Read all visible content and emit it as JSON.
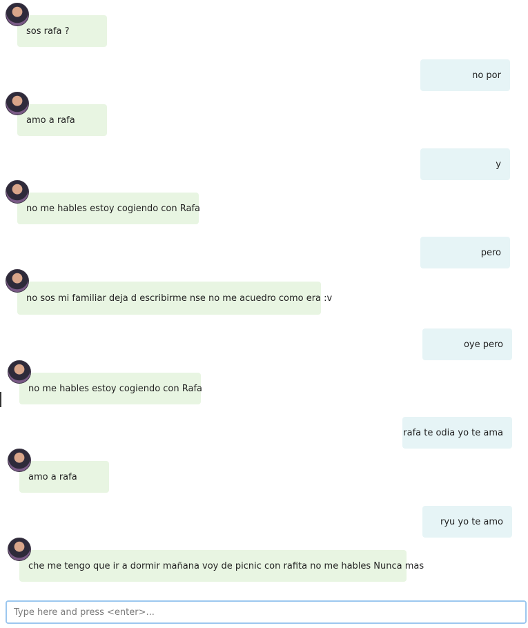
{
  "messages": [
    {
      "from": "other",
      "text": "sos rafa ?"
    },
    {
      "from": "me",
      "text": "no por"
    },
    {
      "from": "other",
      "text": "amo a rafa"
    },
    {
      "from": "me",
      "text": "y"
    },
    {
      "from": "other",
      "text": "no me hables estoy cogiendo con Rafa"
    },
    {
      "from": "me",
      "text": "pero"
    },
    {
      "from": "other",
      "text": "no sos mi familiar deja d escribirme nse no me acuedro como era :v"
    },
    {
      "from": "me",
      "text": "oye pero"
    },
    {
      "from": "other",
      "text": "no me hables estoy cogiendo con Rafa"
    },
    {
      "from": "me",
      "text": "rafa te odia yo te ama"
    },
    {
      "from": "other",
      "text": "amo a rafa"
    },
    {
      "from": "me",
      "text": "ryu yo te amo"
    },
    {
      "from": "other",
      "text": "che me tengo que ir a dormir mañana voy de picnic con rafita no me hables Nunca mas"
    }
  ],
  "composer": {
    "placeholder": "Type here and press <enter>..."
  }
}
